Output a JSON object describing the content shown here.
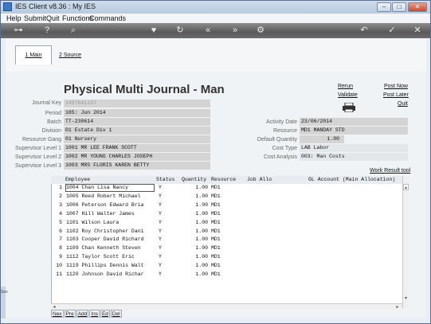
{
  "window": {
    "title": "IES Client v8.36 : My IES",
    "min": "–",
    "max": "□",
    "close": "✕"
  },
  "menu": [
    "Help",
    "Submit",
    "Quit",
    "Functions",
    "Commands"
  ],
  "toolbar_icons": [
    "key-icon",
    "help-icon",
    "search-icon",
    "heart-icon",
    "refresh-icon",
    "rewind-icon",
    "forward-icon",
    "settings-icon",
    "back-icon",
    "check-icon",
    "close-icon"
  ],
  "tabs": {
    "main": "1 Main",
    "source": "2 Source"
  },
  "form": {
    "title": "Physical Multi Journal - Man",
    "links": {
      "rerun": "Rerun",
      "validate": "Validate",
      "post_now": "Post Now",
      "post_later": "Post Later",
      "quit": "Quit"
    },
    "left_labels": [
      "Journal Key",
      "Period",
      "Batch",
      "Division",
      "Resource Gang",
      "Supervisor Level 1",
      "Supervisor Level 2",
      "Supervisor Level 3"
    ],
    "left_values": [
      "1497641107",
      "165: Jun 2014",
      "TT-230614",
      "01 Estate Div 1",
      "01 Nursery",
      "1001 MR LEE FRANK SCOTT",
      "1002 MR YOUNG CHARLES JOSEPH",
      "1003 MRS FLORIS KAREN BETTY"
    ],
    "right_labels": [
      "Activity Date",
      "Resource",
      "Default Quantity",
      "Cost Type",
      "Cost Analysis"
    ],
    "right_values": [
      "23/06/2014",
      "MD1 MANDAY STD",
      "1.00",
      "LAB Labor",
      "003: Man Costs"
    ],
    "work_result_tool": "Work Result tool"
  },
  "grid": {
    "headers": [
      "Employee",
      "Status",
      "Quantity",
      "Resource",
      "Job Allo",
      "GL Account (Main Allocation)"
    ],
    "rows": [
      [
        "1",
        "1004 Chan Lisa Nancy",
        "Y",
        "1.00",
        "MD1"
      ],
      [
        "2",
        "1005 Reed Robert Michael",
        "Y",
        "1.00",
        "MD1"
      ],
      [
        "3",
        "1006 Peterson Edward Bria",
        "Y",
        "1.00",
        "MD1"
      ],
      [
        "4",
        "1007 Hill Walter James",
        "Y",
        "1.00",
        "MD1"
      ],
      [
        "5",
        "1101 Wilson Laura",
        "Y",
        "1.00",
        "MD1"
      ],
      [
        "6",
        "1102 Roy Christopher Dani",
        "Y",
        "1.00",
        "MD1"
      ],
      [
        "7",
        "1103 Cooper David Richard",
        "Y",
        "1.00",
        "MD1"
      ],
      [
        "8",
        "1109 Chan Kenneth Steven",
        "Y",
        "1.00",
        "MD1"
      ],
      [
        "9",
        "1112 Taylor Scott Eric",
        "Y",
        "1.00",
        "MD1"
      ],
      [
        "10",
        "1119 Phillips Dennis Walt",
        "Y",
        "1.00",
        "MD1"
      ],
      [
        "11",
        "1120 Johnson David Richar",
        "Y",
        "1.00",
        "MD1"
      ]
    ],
    "buttons": [
      "Nex",
      "Pre",
      "Add",
      "Ins",
      "Ed",
      "Del"
    ]
  },
  "side_label": "Ses"
}
